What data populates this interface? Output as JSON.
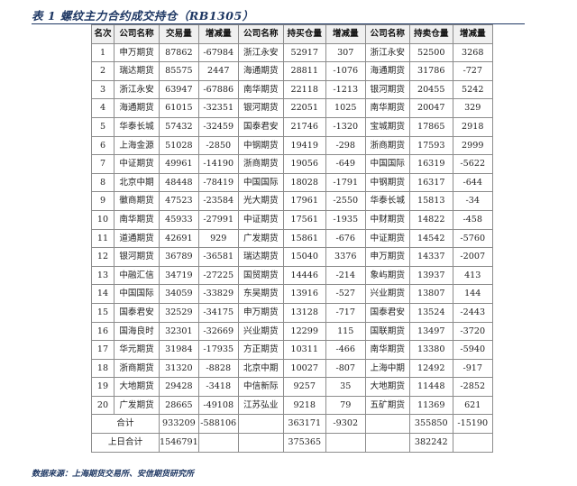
{
  "title": "表 1 螺纹主力合约成交持仓（RB1305）",
  "headers": [
    "名次",
    "公司名称",
    "交易量",
    "增减量",
    "公司名称",
    "持买仓量",
    "增减量",
    "公司名称",
    "持卖仓量",
    "增减量"
  ],
  "rows": [
    [
      "1",
      "申万期货",
      "87862",
      "-67984",
      "浙江永安",
      "52917",
      "307",
      "浙江永安",
      "52500",
      "3268"
    ],
    [
      "2",
      "瑞达期货",
      "85575",
      "2447",
      "海通期货",
      "28811",
      "-1076",
      "海通期货",
      "31786",
      "-727"
    ],
    [
      "3",
      "浙江永安",
      "63947",
      "-67886",
      "南华期货",
      "22118",
      "-1213",
      "银河期货",
      "20455",
      "5242"
    ],
    [
      "4",
      "海通期货",
      "61015",
      "-32351",
      "银河期货",
      "22051",
      "1025",
      "南华期货",
      "20047",
      "329"
    ],
    [
      "5",
      "华泰长城",
      "57432",
      "-32459",
      "国泰君安",
      "21746",
      "-1320",
      "宝城期货",
      "17865",
      "2918"
    ],
    [
      "6",
      "上海金源",
      "51028",
      "-2850",
      "中钢期货",
      "19419",
      "-298",
      "浙商期货",
      "17593",
      "2999"
    ],
    [
      "7",
      "中证期货",
      "49961",
      "-14190",
      "浙商期货",
      "19056",
      "-649",
      "中国国际",
      "16319",
      "-5622"
    ],
    [
      "8",
      "北京中期",
      "48448",
      "-78419",
      "中国国际",
      "18028",
      "-1791",
      "中钢期货",
      "16317",
      "-644"
    ],
    [
      "9",
      "徽商期货",
      "47523",
      "-23584",
      "光大期货",
      "17961",
      "-2550",
      "华泰长城",
      "15813",
      "-34"
    ],
    [
      "10",
      "南华期货",
      "45933",
      "-27991",
      "中证期货",
      "17561",
      "-1935",
      "中财期货",
      "14822",
      "-458"
    ],
    [
      "11",
      "道通期货",
      "42691",
      "929",
      "广发期货",
      "15861",
      "-676",
      "中证期货",
      "14542",
      "-5760"
    ],
    [
      "12",
      "银河期货",
      "36789",
      "-36581",
      "瑞达期货",
      "15040",
      "3376",
      "申万期货",
      "14337",
      "-2007"
    ],
    [
      "13",
      "中融汇信",
      "34719",
      "-27225",
      "国贸期货",
      "14446",
      "-214",
      "象屿期货",
      "13937",
      "413"
    ],
    [
      "14",
      "中国国际",
      "34059",
      "-33829",
      "东吴期货",
      "13916",
      "-527",
      "兴业期货",
      "13807",
      "144"
    ],
    [
      "15",
      "国泰君安",
      "32529",
      "-34175",
      "申万期货",
      "13128",
      "-717",
      "国泰君安",
      "13524",
      "-2443"
    ],
    [
      "16",
      "国海良时",
      "32301",
      "-32669",
      "兴业期货",
      "12299",
      "115",
      "国联期货",
      "13497",
      "-3720"
    ],
    [
      "17",
      "华元期货",
      "31984",
      "-17935",
      "方正期货",
      "10311",
      "-466",
      "南华期货",
      "13380",
      "-5940"
    ],
    [
      "18",
      "浙商期货",
      "31320",
      "-8828",
      "北京中期",
      "10027",
      "-807",
      "上海中期",
      "12492",
      "-917"
    ],
    [
      "19",
      "大地期货",
      "29428",
      "-3418",
      "中信新际",
      "9257",
      "35",
      "大地期货",
      "11448",
      "-2852"
    ],
    [
      "20",
      "广发期货",
      "28665",
      "-49108",
      "江苏弘业",
      "9218",
      "79",
      "五矿期货",
      "11369",
      "621"
    ]
  ],
  "total": {
    "label": "合计",
    "volume": "933209",
    "volume_change": "-588106",
    "buy": "363171",
    "buy_change": "-9302",
    "sell": "355850",
    "sell_change": "-15190"
  },
  "prev_total": {
    "label": "上日合计",
    "volume": "1546791",
    "buy": "375365",
    "sell": "382242"
  },
  "source": "数据来源：上海期货交易所、安信期货研究所"
}
